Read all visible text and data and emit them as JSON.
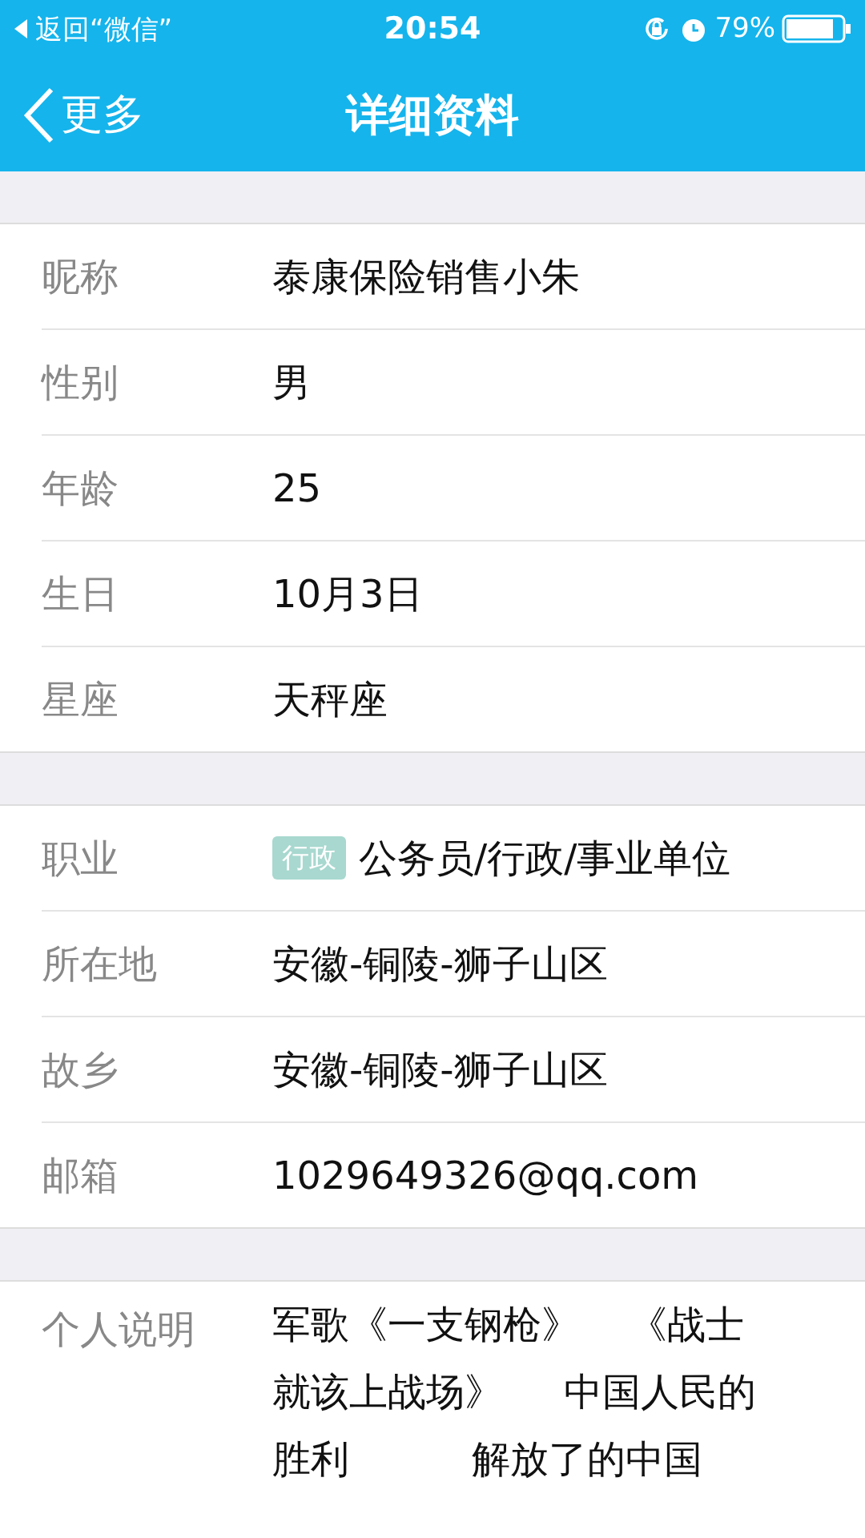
{
  "status_bar": {
    "back_app": "返回“微信”",
    "time": "20:54",
    "battery": "79%"
  },
  "nav": {
    "back": "更多",
    "title": "详细资料"
  },
  "groups": [
    {
      "rows": [
        {
          "label": "昵称",
          "value": "泰康保险销售小朱"
        },
        {
          "label": "性别",
          "value": "男"
        },
        {
          "label": "年龄",
          "value": "25"
        },
        {
          "label": "生日",
          "value": "10月3日"
        },
        {
          "label": "星座",
          "value": "天秤座"
        }
      ]
    },
    {
      "rows": [
        {
          "label": "职业",
          "tag": "行政",
          "value": "公务员/行政/事业单位"
        },
        {
          "label": "所在地",
          "value": "安徽-铜陵-狮子山区"
        },
        {
          "label": "故乡",
          "value": "安徽-铜陵-狮子山区"
        },
        {
          "label": "邮箱",
          "value": "1029649326@qq.com"
        }
      ]
    }
  ],
  "bio": {
    "label": "个人说明",
    "lines": [
      "军歌《一支钢枪》    《战士",
      "就该上战场》     中国人民的",
      "胜利          解放了的中国"
    ]
  }
}
